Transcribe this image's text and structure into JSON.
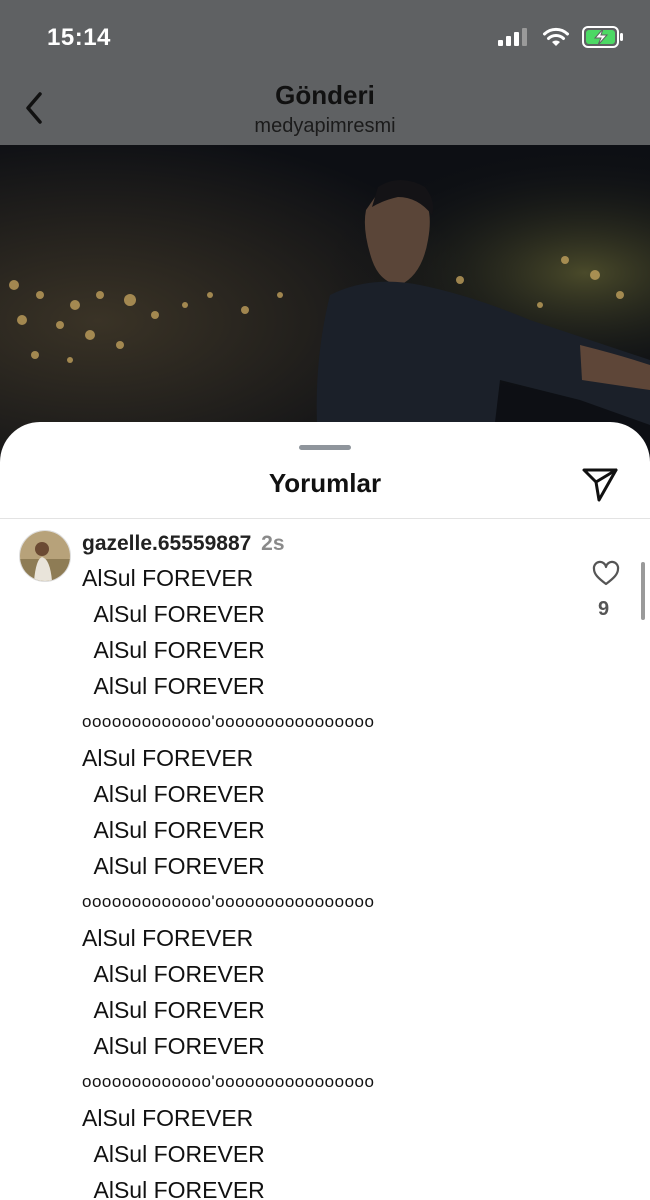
{
  "status_bar": {
    "time": "15:14"
  },
  "nav": {
    "title": "Gönderi",
    "subtitle": "medyapimresmi"
  },
  "comments_sheet": {
    "title": "Yorumlar",
    "comment": {
      "username": "gazelle.65559887",
      "time": "2s",
      "likes": "9",
      "lines": [
        "AlSul FOREVER",
        "  AlSul FOREVER",
        "  AlSul FOREVER",
        "  AlSul FOREVER",
        "ooooooooooooo'oooooooooooooooo",
        "AlSul FOREVER",
        "  AlSul FOREVER",
        "  AlSul FOREVER",
        "  AlSul FOREVER",
        "ooooooooooooo'oooooooooooooooo",
        "AlSul FOREVER",
        "  AlSul FOREVER",
        "  AlSul FOREVER",
        "  AlSul FOREVER",
        "ooooooooooooo'oooooooooooooooo",
        "AlSul FOREVER",
        "  AlSul FOREVER",
        "  AlSul FOREVER"
      ]
    }
  },
  "icons": {
    "back": "chevron-left-icon",
    "share": "paper-plane-icon",
    "like": "heart-icon",
    "signal": "signal-icon",
    "wifi": "wifi-icon",
    "battery": "battery-charging-icon"
  },
  "colors": {
    "overlay": "#5f6163",
    "battery_fill": "#4cd964"
  }
}
